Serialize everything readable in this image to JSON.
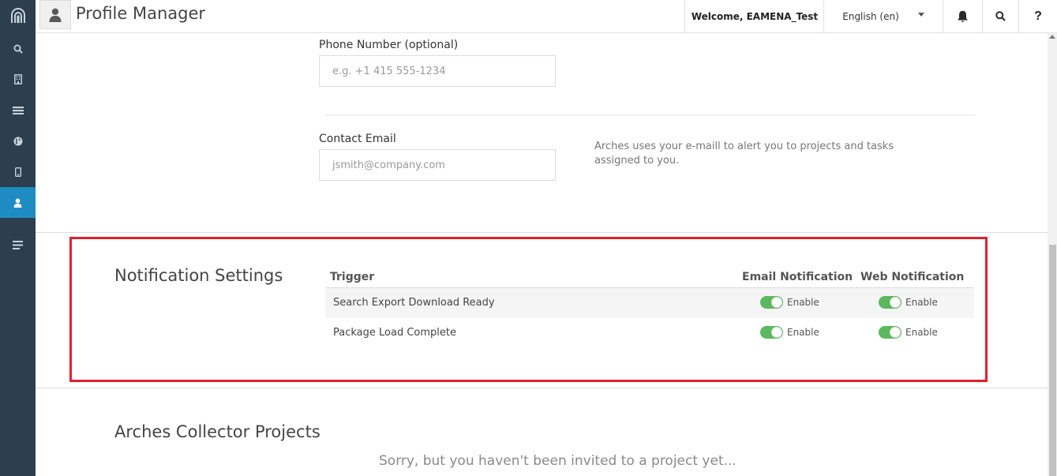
{
  "header": {
    "title": "Profile Manager",
    "welcome": "Welcome, EAMENA_Test",
    "language": "English (en)",
    "help": "?"
  },
  "sidebar": {
    "items": [
      {
        "icon": "search-icon"
      },
      {
        "icon": "building-icon"
      },
      {
        "icon": "list-icon"
      },
      {
        "icon": "globe-icon"
      },
      {
        "icon": "mobile-icon"
      },
      {
        "icon": "user-icon",
        "active": true
      },
      {
        "icon": "menu-icon"
      }
    ]
  },
  "profile": {
    "phone_label": "Phone Number (optional)",
    "phone_placeholder": "e.g. +1 415 555-1234",
    "email_label": "Contact Email",
    "email_placeholder": "jsmith@company.com",
    "email_help": "Arches uses your e-maill to alert you to projects and tasks assigned to you."
  },
  "notifications": {
    "title": "Notification Settings",
    "columns": {
      "trigger": "Trigger",
      "email": "Email Notification",
      "web": "Web Notification"
    },
    "rows": [
      {
        "trigger": "Search Export Download Ready",
        "email_label": "Enable",
        "email_on": true,
        "web_label": "Enable",
        "web_on": true
      },
      {
        "trigger": "Package Load Complete",
        "email_label": "Enable",
        "email_on": true,
        "web_label": "Enable",
        "web_on": true
      }
    ]
  },
  "projects": {
    "title": "Arches Collector Projects",
    "empty_message": "Sorry, but you haven't been invited to a project yet..."
  },
  "colors": {
    "sidebar": "#2d3e4f",
    "sidebar_active": "#1e8bc3",
    "toggle_on": "#5cb85c",
    "highlight": "#e1202f"
  }
}
